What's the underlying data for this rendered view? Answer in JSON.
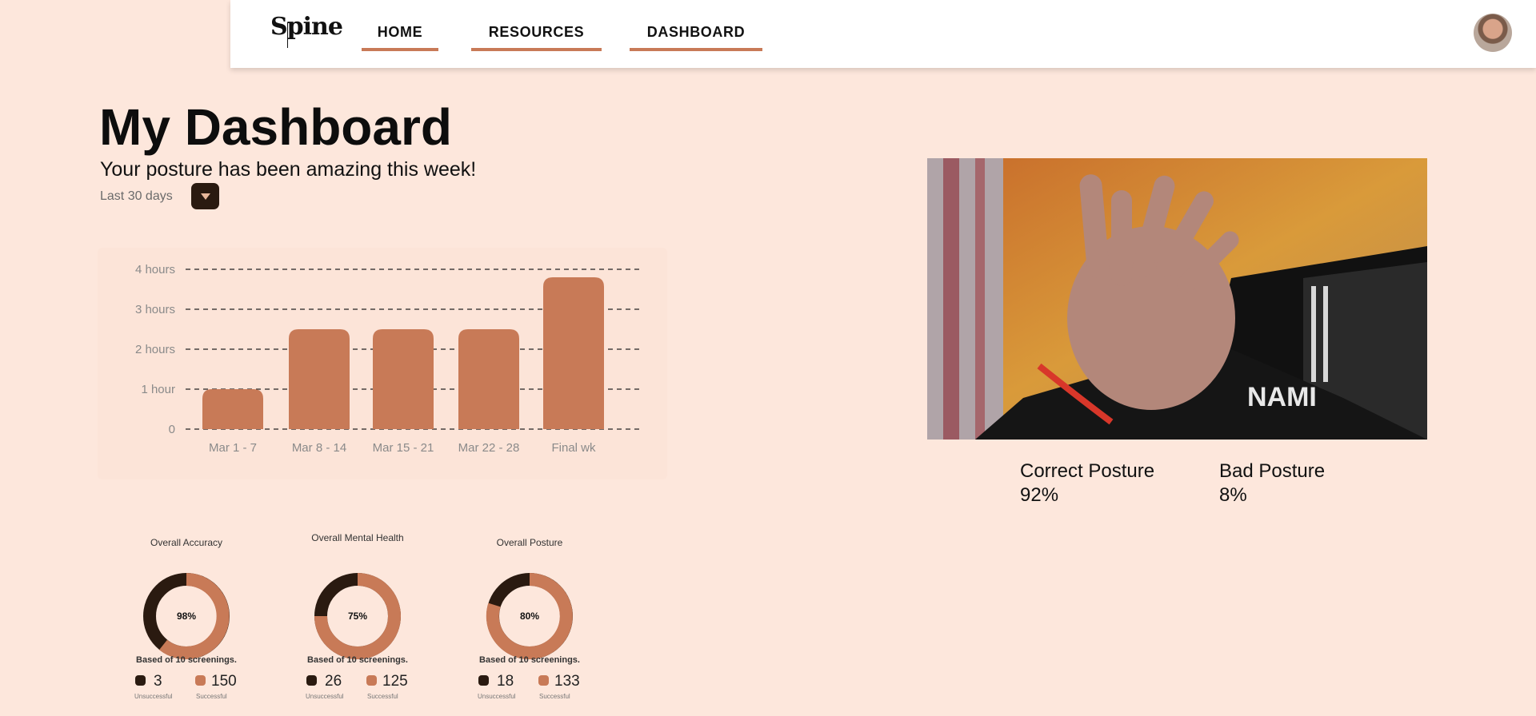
{
  "header": {
    "logo": "Spine",
    "nav": [
      {
        "label": "HOME"
      },
      {
        "label": "RESOURCES"
      },
      {
        "label": "DASHBOARD"
      }
    ],
    "accent": "#c87a57"
  },
  "main": {
    "title": "My Dashboard",
    "subtitle": "Your posture has been amazing this week!",
    "range_label": "Last 30 days"
  },
  "chart_data": {
    "type": "bar",
    "categories": [
      "Mar 1 - 7",
      "Mar 8 - 14",
      "Mar 15 - 21",
      "Mar 22 - 28",
      "Final wk"
    ],
    "values": [
      1,
      2.5,
      2.5,
      2.5,
      3.8
    ],
    "y_ticks": [
      "0",
      "1 hour",
      "2 hours",
      "3 hours",
      "4 hours"
    ],
    "ylim": [
      0,
      4
    ],
    "grid": "dashed",
    "bar_color": "#c87a57"
  },
  "webcam": {
    "correct_label": "Correct Posture",
    "correct_value": "92%",
    "bad_label": "Bad Posture",
    "bad_value": "8%"
  },
  "donuts": [
    {
      "title": "Overall Accuracy",
      "percent": "98%",
      "note": "Based of 10 screenings.",
      "unsuccessful": "3",
      "successful": "150",
      "unsuccessful_label": "Unsuccessful",
      "successful_label": "Successful"
    },
    {
      "title": "Overall Mental Health",
      "percent": "75%",
      "note": "Based of 10 screenings.",
      "unsuccessful": "26",
      "successful": "125",
      "unsuccessful_label": "Unsuccessful",
      "successful_label": "Successful"
    },
    {
      "title": "Overall Posture",
      "percent": "80%",
      "note": "Based of 10 screenings.",
      "unsuccessful": "18",
      "successful": "133",
      "unsuccessful_label": "Unsuccessful",
      "successful_label": "Successful"
    }
  ],
  "colors": {
    "dark": "#2a1a10",
    "accent": "#c87a57",
    "background": "#fde7dc"
  }
}
